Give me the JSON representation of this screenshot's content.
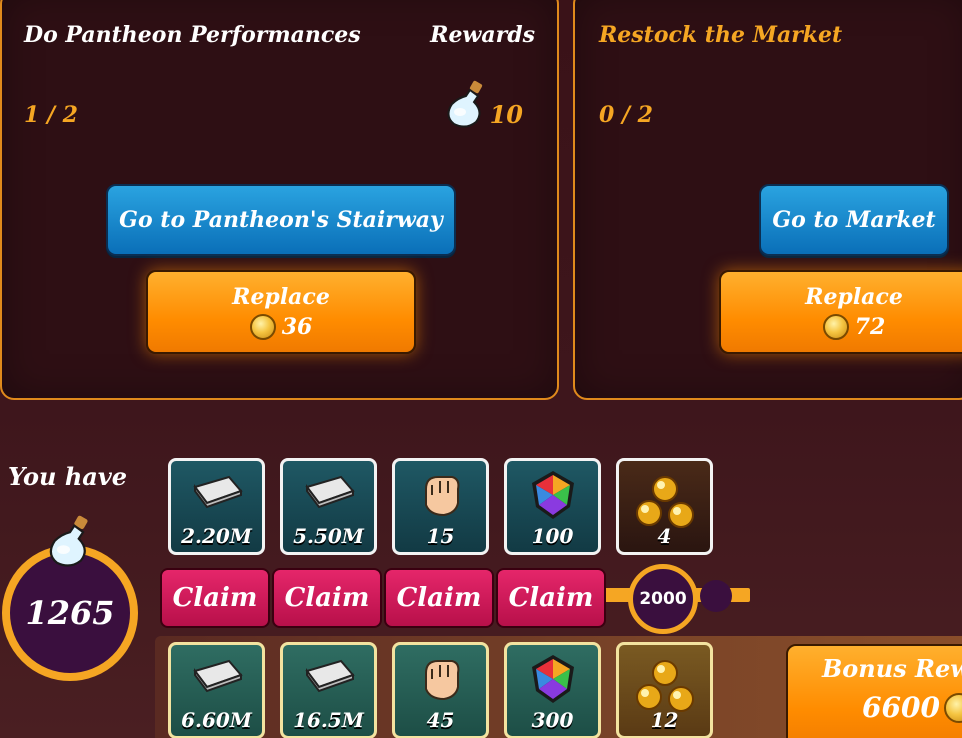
{
  "quests": [
    {
      "title": "Do Pantheon Performances",
      "rewards_header": "Rewards",
      "progress": "1 / 2",
      "reward_amount": "10",
      "reward_icon": "potion-icon",
      "go_button": "Go to Pantheon's Stairway",
      "replace_label": "Replace",
      "replace_cost": "36"
    },
    {
      "title": "Restock the Market",
      "progress": "0 / 2",
      "go_button": "Go to Market",
      "replace_label": "Replace",
      "replace_cost": "72"
    }
  ],
  "you_have": {
    "label": "You have",
    "amount": "1265",
    "icon": "potion-icon"
  },
  "reward_track": {
    "tier_rewards": [
      {
        "icon": "money-stack-icon",
        "amount": "2.20M"
      },
      {
        "icon": "money-stack-icon",
        "amount": "5.50M"
      },
      {
        "icon": "fist-icon",
        "amount": "15"
      },
      {
        "icon": "rainbow-gem-icon",
        "amount": "100"
      },
      {
        "icon": "gold-orbs-icon",
        "amount": "4"
      }
    ],
    "claim_labels": [
      "Claim",
      "Claim",
      "Claim",
      "Claim"
    ],
    "milestone": "2000",
    "bonus_rewards": [
      {
        "icon": "money-stack-icon",
        "amount": "6.60M"
      },
      {
        "icon": "money-stack-icon",
        "amount": "16.5M"
      },
      {
        "icon": "fist-icon",
        "amount": "45"
      },
      {
        "icon": "rainbow-gem-icon",
        "amount": "300"
      },
      {
        "icon": "gold-orbs-icon",
        "amount": "12"
      }
    ],
    "bonus_button": {
      "label": "Bonus Rew",
      "cost": "6600"
    }
  },
  "colors": {
    "accent_orange": "#ff8c00",
    "accent_gold": "#f5a623",
    "claim_pink": "#d41c5c",
    "button_blue": "#1a8ad0"
  }
}
